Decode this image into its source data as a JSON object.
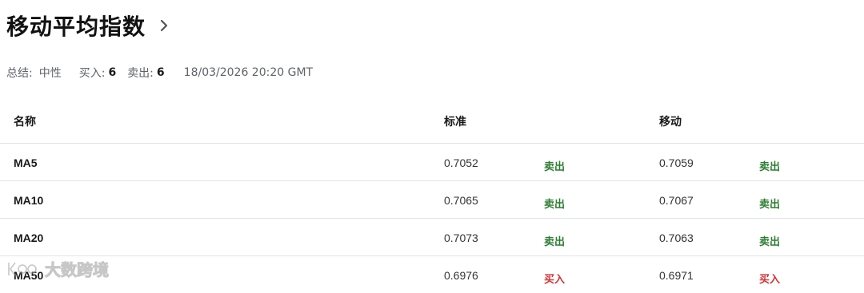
{
  "header": {
    "title": "移动平均指数"
  },
  "summary": {
    "summary_label": "总结:",
    "summary_value": "中性",
    "buy_label": "买入:",
    "buy_count": "6",
    "sell_label": "卖出:",
    "sell_count": "6",
    "timestamp": "18/03/2026 20:20 GMT"
  },
  "table": {
    "columns": {
      "name": "名称",
      "standard": "标准",
      "moving": "移动"
    },
    "rows": [
      {
        "name": "MA5",
        "standard_value": "0.7052",
        "standard_action": "卖出",
        "standard_signal": "sell",
        "moving_value": "0.7059",
        "moving_action": "卖出",
        "moving_signal": "sell"
      },
      {
        "name": "MA10",
        "standard_value": "0.7065",
        "standard_action": "卖出",
        "standard_signal": "sell",
        "moving_value": "0.7067",
        "moving_action": "卖出",
        "moving_signal": "sell"
      },
      {
        "name": "MA20",
        "standard_value": "0.7073",
        "standard_action": "卖出",
        "standard_signal": "sell",
        "moving_value": "0.7063",
        "moving_action": "卖出",
        "moving_signal": "sell"
      },
      {
        "name": "MA50",
        "standard_value": "0.6976",
        "standard_action": "买入",
        "standard_signal": "buy",
        "moving_value": "0.6971",
        "moving_action": "买入",
        "moving_signal": "buy"
      }
    ]
  },
  "colors": {
    "sell": "#2e7d32",
    "buy": "#d32f2f"
  },
  "icons": {
    "header_chevron": "chevron-right-icon",
    "watermark_logo": "watermark-logo-icon"
  },
  "watermark": {
    "text": "大数跨境"
  }
}
